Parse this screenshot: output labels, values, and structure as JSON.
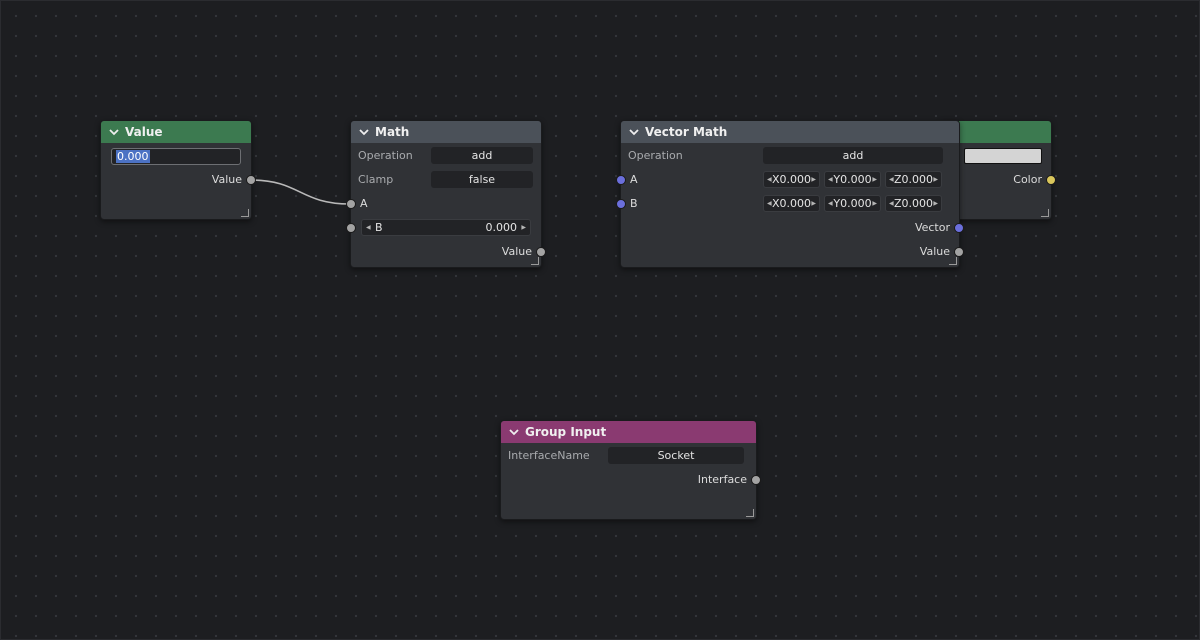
{
  "colors": {
    "background": "#1d1e21",
    "header_green": "#3c7a50",
    "header_gray": "#4b5159",
    "header_pink": "#8a3a71",
    "socket_float": "#a3a3a3",
    "socket_vector": "#6b6fdc",
    "socket_color": "#d9c65c",
    "selection": "#4c72c4"
  },
  "nodes": {
    "value": {
      "title": "Value",
      "value_field": "0.000",
      "output_label": "Value"
    },
    "math": {
      "title": "Math",
      "operation_label": "Operation",
      "operation_value": "add",
      "clamp_label": "Clamp",
      "clamp_value": "false",
      "input_a": "A",
      "input_b_label": "B",
      "input_b_value": "0.000",
      "output_label": "Value"
    },
    "vector_math": {
      "title": "Vector Math",
      "operation_label": "Operation",
      "operation_value": "add",
      "input_a": "A",
      "input_b": "B",
      "a_x": "X0.000",
      "a_y": "Y0.000",
      "a_z": "Z0.000",
      "b_x": "X0.000",
      "b_y": "Y0.000",
      "b_z": "Z0.000",
      "output_vector": "Vector",
      "output_value": "Value"
    },
    "color": {
      "swatch_color": "#d4d4d4",
      "output_label": "Color"
    },
    "group_input": {
      "title": "Group Input",
      "interface_name_label": "InterfaceName",
      "interface_name_value": "Socket",
      "output_label": "Interface"
    }
  },
  "links": [
    {
      "from": "Value.Value",
      "to": "Math.A"
    }
  ]
}
